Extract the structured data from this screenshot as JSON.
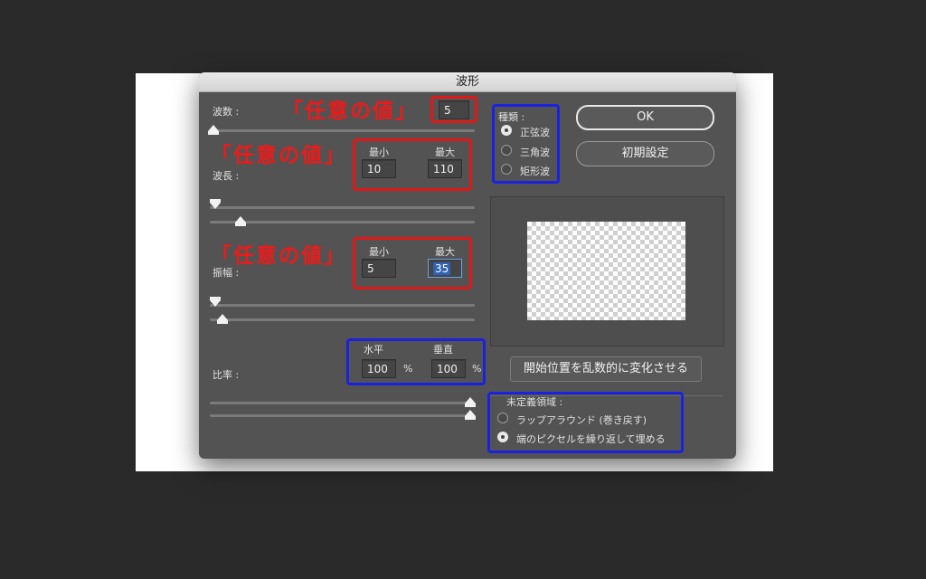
{
  "dialog": {
    "title": "波形"
  },
  "generators": {
    "label": "波数 :",
    "value": "5",
    "slider_fraction": 0.0
  },
  "wavelength": {
    "label": "波長 :",
    "min_label": "最小",
    "max_label": "最大",
    "min_value": "10",
    "max_value": "110"
  },
  "amplitude": {
    "label": "振幅 :",
    "min_label": "最小",
    "max_label": "最大",
    "min_value": "5",
    "max_value": "35"
  },
  "scale": {
    "label": "比率 :",
    "h_label": "水平",
    "v_label": "垂直",
    "h_value": "100",
    "v_value": "100",
    "unit": "%"
  },
  "type": {
    "label": "種類 :",
    "options": [
      "正弦波",
      "三角波",
      "矩形波"
    ],
    "selected": 0
  },
  "buttons": {
    "ok": "OK",
    "defaults": "初期設定",
    "randomize": "開始位置を乱数的に変化させる"
  },
  "undefined_areas": {
    "label": "未定義領域 :",
    "options": [
      "ラップアラウンド (巻き戻す)",
      "端のピクセルを繰り返して埋める"
    ],
    "selected": 1
  },
  "annotations": {
    "red_text": "「任意の値」"
  },
  "colors": {
    "red": "#e01818",
    "blue": "#1a22e0",
    "dialog_bg": "#535353"
  }
}
